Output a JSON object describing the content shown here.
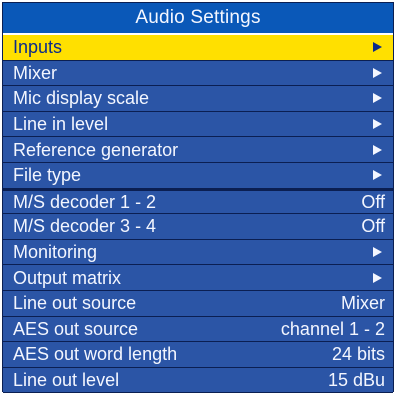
{
  "title": "Audio Settings",
  "items": [
    {
      "label": "Inputs",
      "value": "",
      "icon": "chevron-right-icon"
    },
    {
      "label": "Mixer",
      "value": "",
      "icon": "chevron-right-icon"
    },
    {
      "label": "Mic display scale",
      "value": "",
      "icon": "chevron-right-icon"
    },
    {
      "label": "Line in level",
      "value": "",
      "icon": "chevron-right-icon"
    },
    {
      "label": "Reference generator",
      "value": "",
      "icon": "chevron-right-icon"
    },
    {
      "label": "File type",
      "value": "",
      "icon": "chevron-right-icon"
    },
    {
      "label": "M/S decoder 1 - 2",
      "value": "Off",
      "icon": ""
    },
    {
      "label": "M/S decoder 3 - 4",
      "value": "Off",
      "icon": ""
    },
    {
      "label": "Monitoring",
      "value": "",
      "icon": "chevron-right-icon"
    },
    {
      "label": "Output matrix",
      "value": "",
      "icon": "chevron-right-icon"
    },
    {
      "label": "Line out source",
      "value": "Mixer",
      "icon": ""
    },
    {
      "label": "AES out source",
      "value": "channel 1 - 2",
      "icon": ""
    },
    {
      "label": "AES out word length",
      "value": "24 bits",
      "icon": ""
    },
    {
      "label": "Line out level",
      "value": "15 dBu",
      "icon": ""
    }
  ],
  "colors": {
    "title_background": "#0a58b8",
    "row_background": "#2b55a6",
    "selected_background": "#ffe000",
    "selected_text": "#0b2a8a",
    "text": "#f3f6ff"
  }
}
